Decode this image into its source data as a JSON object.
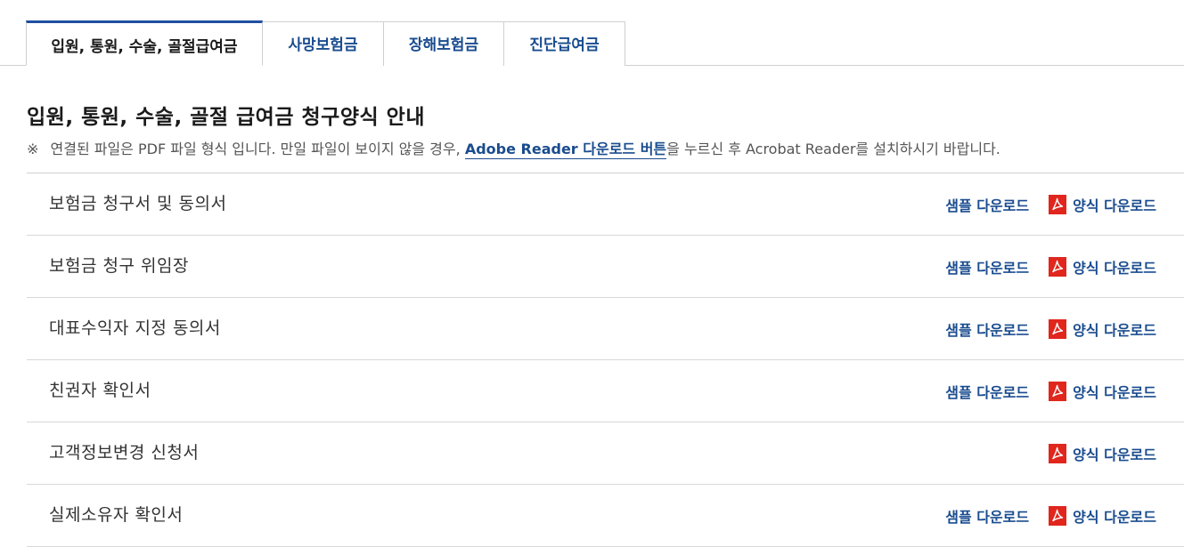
{
  "tabs": [
    {
      "label": "입원, 통원, 수술, 골절급여금",
      "active": true
    },
    {
      "label": "사망보험금",
      "active": false
    },
    {
      "label": "장해보험금",
      "active": false
    },
    {
      "label": "진단급여금",
      "active": false
    }
  ],
  "section": {
    "title": "입원, 통원, 수술, 골절 급여금 청구양식 안내",
    "notice_mark": "※",
    "notice_before": "연결된 파일은 PDF 파일 형식 입니다. 만일 파일이 보이지 않을 경우,",
    "notice_link": "Adobe Reader 다운로드 버튼",
    "notice_after": "을 누르신 후 Acrobat Reader를 설치하시기 바랍니다."
  },
  "actions": {
    "sample_label": "샘플 다운로드",
    "form_label": "양식 다운로드",
    "pdf_icon": "pdf-icon"
  },
  "forms": [
    {
      "name": "보험금 청구서 및 동의서",
      "has_sample": true
    },
    {
      "name": "보험금 청구 위임장",
      "has_sample": true
    },
    {
      "name": "대표수익자 지정 동의서",
      "has_sample": true
    },
    {
      "name": "친권자 확인서",
      "has_sample": true
    },
    {
      "name": "고객정보변경 신청서",
      "has_sample": false
    },
    {
      "name": "실제소유자 확인서",
      "has_sample": true
    }
  ],
  "colors": {
    "accent": "#1a4c8f",
    "tab_active_border": "#1f4fa3",
    "pdf_red": "#e0261d"
  }
}
